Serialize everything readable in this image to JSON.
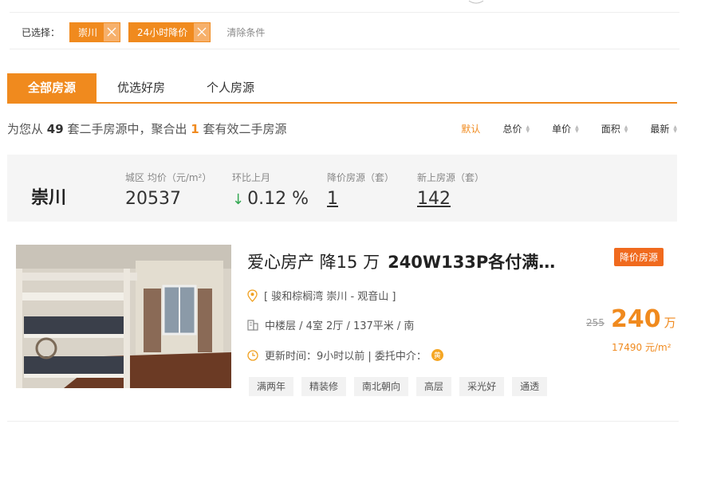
{
  "filters": {
    "label": "已选择：",
    "chips": [
      "崇川",
      "24小时降价"
    ],
    "clear": "清除条件"
  },
  "tabs": [
    "全部房源",
    "优选好房",
    "个人房源"
  ],
  "summary": {
    "prefix": "为您从",
    "total": "49",
    "middle": "套二手房源中，聚合出",
    "matched": "1",
    "suffix": "套有效二手房源"
  },
  "sort": [
    "默认",
    "总价",
    "单价",
    "面积",
    "最新"
  ],
  "stats": {
    "city": "崇川",
    "avg_price_label": "城区 均价（元/m²）",
    "avg_price": "20537",
    "mom_label": "环比上月",
    "mom_value": "0.12 %",
    "drop_label": "降价房源（套）",
    "drop_value": "1",
    "new_label": "新上房源（套）",
    "new_value": "142"
  },
  "listing": {
    "title_main": "爱心房产 降15 万",
    "title_bold": "240W133P各付满…",
    "badge": "降价房源",
    "location": "[ 骏和棕榈湾 崇川 - 观音山 ]",
    "layout": "中楼层 / 4室 2厅 / 137平米 / 南",
    "updated": "更新时间：9小时以前 | 委托中介：",
    "agent_icon": "黄",
    "old_price": "255",
    "price": "240",
    "price_unit": "万",
    "unit_price": "17490 元/m²",
    "tags": [
      "满两年",
      "精装修",
      "南北朝向",
      "高层",
      "采光好",
      "通透"
    ]
  }
}
